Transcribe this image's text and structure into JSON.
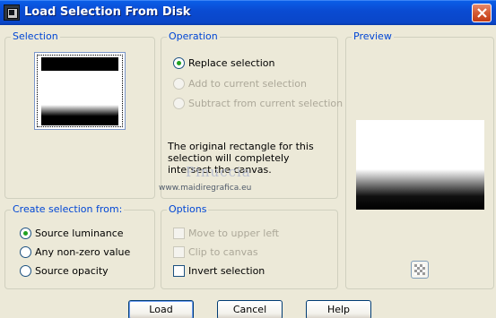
{
  "window": {
    "title": "Load Selection From Disk"
  },
  "selection": {
    "group_label": "Selection"
  },
  "operation": {
    "group_label": "Operation",
    "options": [
      {
        "label": "Replace selection",
        "checked": true,
        "enabled": true
      },
      {
        "label": "Add to current selection",
        "checked": false,
        "enabled": false
      },
      {
        "label": "Subtract from current selection",
        "checked": false,
        "enabled": false
      }
    ],
    "info": "The original rectangle for this selection will completely intersect the canvas."
  },
  "watermark": {
    "name": "Pinuccia",
    "url": "www.maidiregrafica.eu"
  },
  "preview": {
    "group_label": "Preview",
    "checkerboard_icon": "checkerboard-icon"
  },
  "create_from": {
    "group_label": "Create selection from:",
    "options": [
      {
        "label": "Source luminance",
        "checked": true
      },
      {
        "label": "Any non-zero value",
        "checked": false
      },
      {
        "label": "Source opacity",
        "checked": false
      }
    ]
  },
  "options": {
    "group_label": "Options",
    "items": [
      {
        "label": "Move to upper left",
        "checked": false,
        "enabled": false
      },
      {
        "label": "Clip to canvas",
        "checked": false,
        "enabled": false
      },
      {
        "label": "Invert selection",
        "checked": false,
        "enabled": true
      }
    ]
  },
  "buttons": {
    "load": "Load",
    "cancel": "Cancel",
    "help": "Help"
  },
  "colors": {
    "title_bar": "#0a4bd2",
    "group_label": "#0046d5",
    "dialog_bg": "#ece9d8",
    "radio_checked": "#21a121"
  }
}
